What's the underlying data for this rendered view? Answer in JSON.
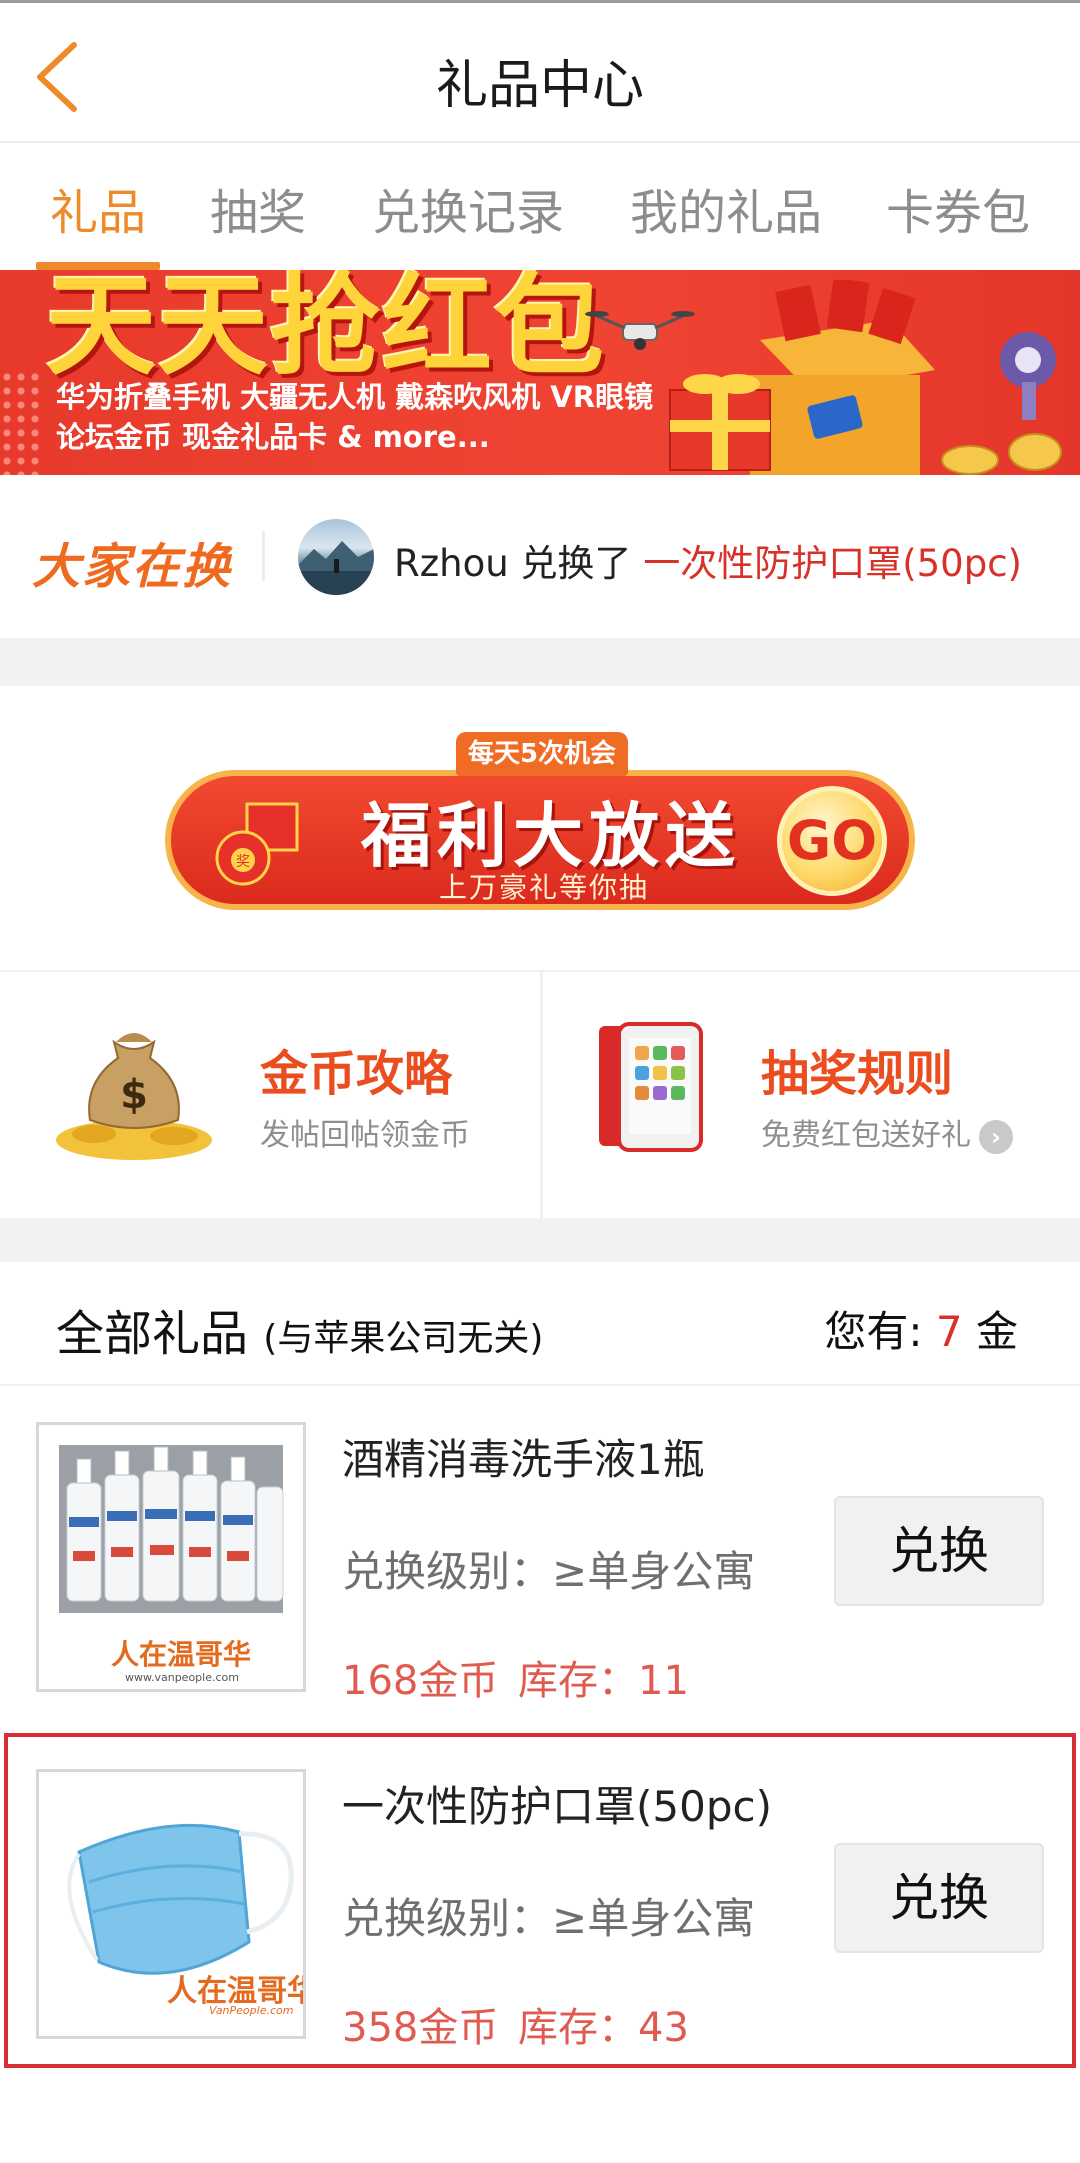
{
  "header": {
    "title": "礼品中心"
  },
  "tabs": [
    {
      "label": "礼品",
      "active": true
    },
    {
      "label": "抽奖",
      "active": false
    },
    {
      "label": "兑换记录",
      "active": false
    },
    {
      "label": "我的礼品",
      "active": false
    },
    {
      "label": "卡券包",
      "active": false
    }
  ],
  "banner": {
    "title": "天天抢红包",
    "line1": "华为折叠手机 大疆无人机 戴森吹风机 VR眼镜",
    "line2": "论坛金币 现金礼品卡 & more..."
  },
  "ticker": {
    "label": "大家在换",
    "user": "Rzhou",
    "action": "兑换了",
    "item": "一次性防护口罩(50pc)"
  },
  "welfare": {
    "tag": "每天5次机会",
    "title": "福利大放送",
    "subtitle": "上万豪礼等你抽",
    "go": "GO"
  },
  "cards": [
    {
      "title": "金币攻略",
      "subtitle": "发帖回帖领金币"
    },
    {
      "title": "抽奖规则",
      "subtitle": "免费红包送好礼"
    }
  ],
  "gifts_section": {
    "title": "全部礼品",
    "note": "(与苹果公司无关)",
    "balance_prefix": "您有:",
    "balance_value": "7",
    "balance_unit": "金"
  },
  "gifts": [
    {
      "name": "酒精消毒洗手液1瓶",
      "level": "兑换级别：≥单身公寓",
      "price": "168金币",
      "stock": "库存：11",
      "button": "兑换",
      "watermark": "人在温哥华",
      "watermark_url": "www.vanpeople.com"
    },
    {
      "name": "一次性防护口罩(50pc)",
      "level": "兑换级别：≥单身公寓",
      "price": "358金币",
      "stock": "库存：43",
      "button": "兑换",
      "watermark": "人在温哥华",
      "watermark_url": "VanPeople.com"
    }
  ],
  "colors": {
    "accent": "#ef8a2a",
    "banner_red": "#e83a2b",
    "price_red": "#df5a4f",
    "highlight_border": "#d62f35"
  }
}
